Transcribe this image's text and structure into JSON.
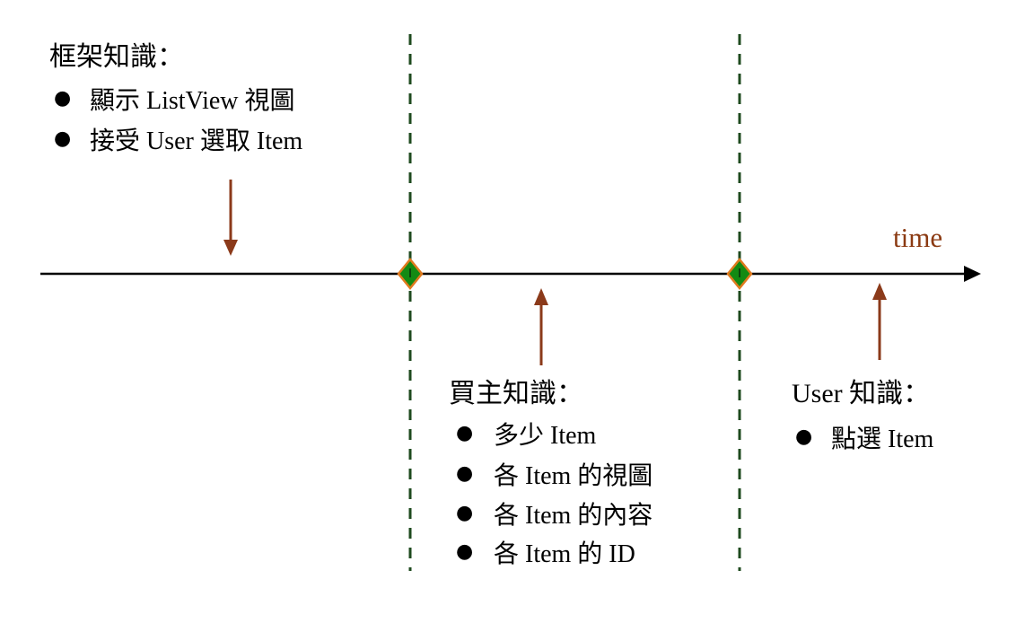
{
  "time_label": "time",
  "bullet_glyph": "●",
  "framework": {
    "title": "框架知識：",
    "items": [
      "顯示 ListView 視圖",
      "接受 User 選取 Item"
    ]
  },
  "buyer": {
    "title": "買主知識：",
    "items": [
      "多少 Item",
      "各 Item 的視圖",
      "各 Item 的內容",
      "各 Item 的 ID"
    ]
  },
  "user": {
    "title": "User 知識：",
    "items": [
      "點選 Item"
    ]
  },
  "colors": {
    "axis": "#000000",
    "arrow": "#8b3a1a",
    "time_label": "#8b3a12",
    "divider": "#1e4a1e",
    "diamond_fill": "#138a13",
    "diamond_border": "#e07a1e"
  }
}
